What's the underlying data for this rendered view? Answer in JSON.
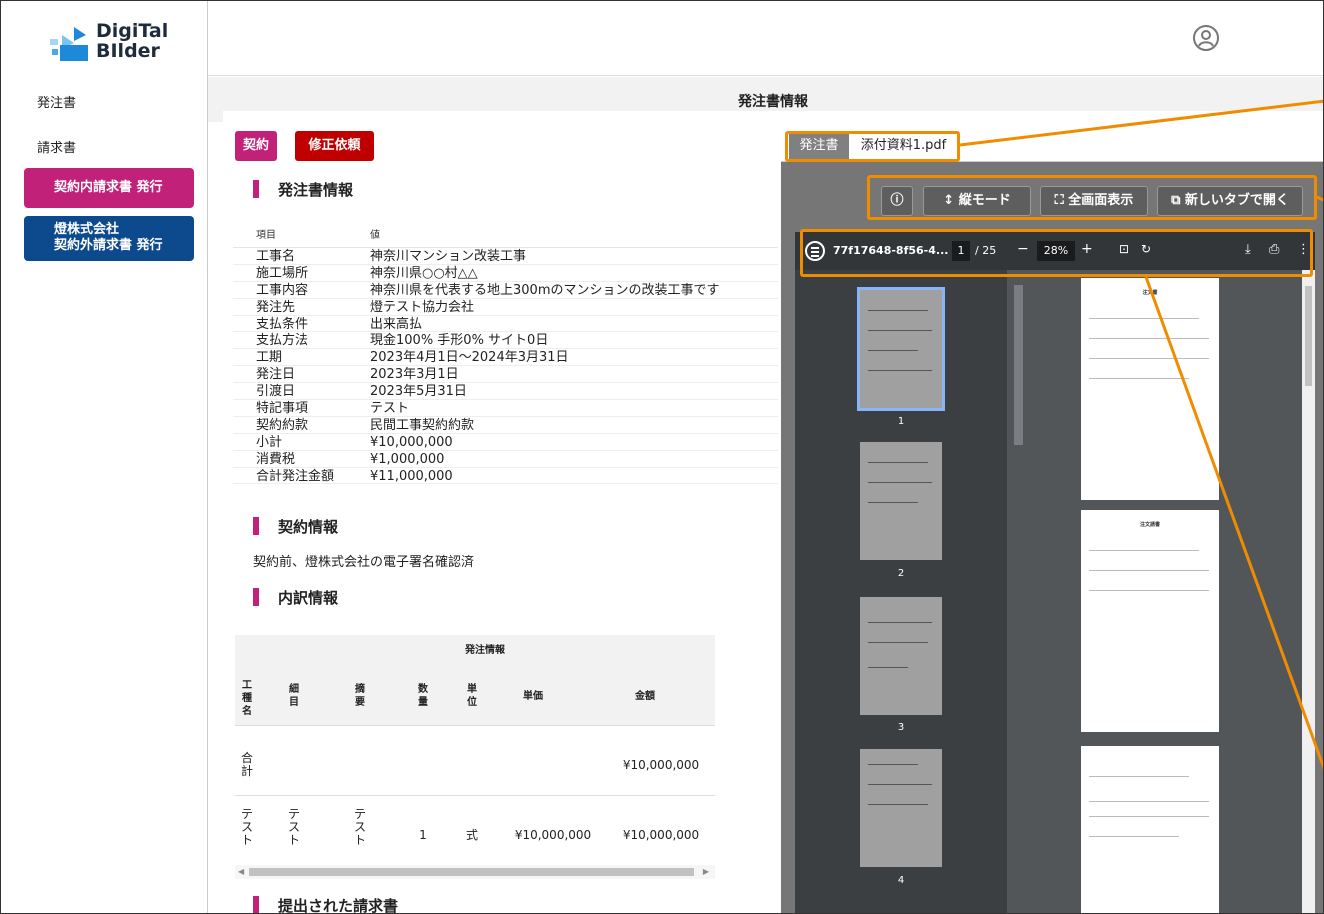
{
  "app": {
    "logo_line1": "DigiTal",
    "logo_line2": "BIlder"
  },
  "sidebar": {
    "nav": [
      "発注書",
      "請求書"
    ],
    "btn_contract_invoice": "契約内請求書 発行",
    "btn_outside_1": "燈株式会社",
    "btn_outside_2": "契約外請求書 発行"
  },
  "page_title": "発注書情報",
  "actions": {
    "contract": "契約",
    "revise": "修正依頼"
  },
  "po": {
    "heading": "発注書情報",
    "col_item": "項目",
    "col_value": "値",
    "rows": [
      {
        "k": "工事名",
        "v": "神奈川マンション改装工事"
      },
      {
        "k": "施工場所",
        "v": "神奈川県○○村△△"
      },
      {
        "k": "工事内容",
        "v": "神奈川県を代表する地上300mのマンションの改装工事です"
      },
      {
        "k": "発注先",
        "v": "燈テスト協力会社"
      },
      {
        "k": "支払条件",
        "v": "出来高払"
      },
      {
        "k": "支払方法",
        "v": "現金100% 手形0% サイト0日"
      },
      {
        "k": "工期",
        "v": "2023年4月1日～2024年3月31日"
      },
      {
        "k": "発注日",
        "v": "2023年3月1日"
      },
      {
        "k": "引渡日",
        "v": "2023年5月31日"
      },
      {
        "k": "特記事項",
        "v": "テスト"
      },
      {
        "k": "契約約款",
        "v": "民間工事契約約款"
      },
      {
        "k": "小計",
        "v": "¥10,000,000"
      },
      {
        "k": "消費税",
        "v": "¥1,000,000"
      },
      {
        "k": "合計発注金額",
        "v": "¥11,000,000"
      }
    ]
  },
  "contract": {
    "heading": "契約情報",
    "text": "契約前、燈株式会社の電子署名確認済"
  },
  "breakdown": {
    "heading": "内訳情報",
    "group": "発注情報",
    "cols": [
      "工\n種\n名",
      "細\n目",
      "摘\n要",
      "数\n量",
      "単\n位",
      "単価",
      "金額"
    ],
    "total_label": "合\n計",
    "total_amount": "¥10,000,000",
    "row": [
      "テ\nス\nト",
      "テ\nス\nト",
      "テ\nス\nト",
      "1",
      "式",
      "¥10,000,000",
      "¥10,000,000"
    ]
  },
  "submitted": {
    "heading": "提出された請求書"
  },
  "viewer": {
    "tabs": [
      "発注書",
      "添付資料1.pdf"
    ],
    "btn_info": "ⓘ",
    "btn_vertical": "↕ 縦モード",
    "btn_fullscreen": "⛶ 全画面表示",
    "btn_newtab": "⧉ 新しいタブで開く",
    "file": "77f17648-8f56-4...",
    "page": "1",
    "pages": "/ 25",
    "zoom": "28%",
    "thumb_pages": [
      "1",
      "2",
      "3",
      "4"
    ],
    "doc1_title": "注文書",
    "doc2_title": "注文請書"
  },
  "colors": {
    "accent": "#c2217a",
    "danger": "#c00000",
    "navy": "#0c4a8d",
    "callout": "#f08c00"
  }
}
